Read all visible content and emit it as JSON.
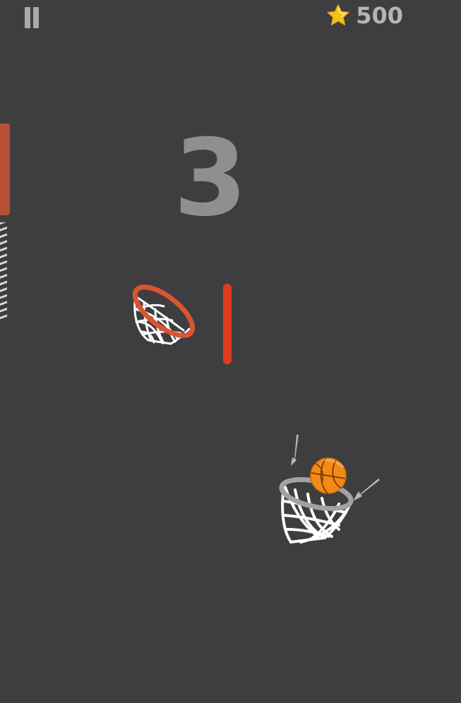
{
  "hud": {
    "pause_icon": "pause-icon",
    "coin_icon": "star-icon",
    "coin_count": "500"
  },
  "score": "3",
  "colors": {
    "background": "#3e3d40",
    "target_rim": "#d9552f",
    "obstacle": "#e23a1f",
    "active_rim": "#a2a2a4",
    "net": "#ffffff",
    "ball": "#f28a16",
    "star": "#f5c21a",
    "hud_text": "#b4b4b6",
    "score_text": "#8f8f92"
  }
}
